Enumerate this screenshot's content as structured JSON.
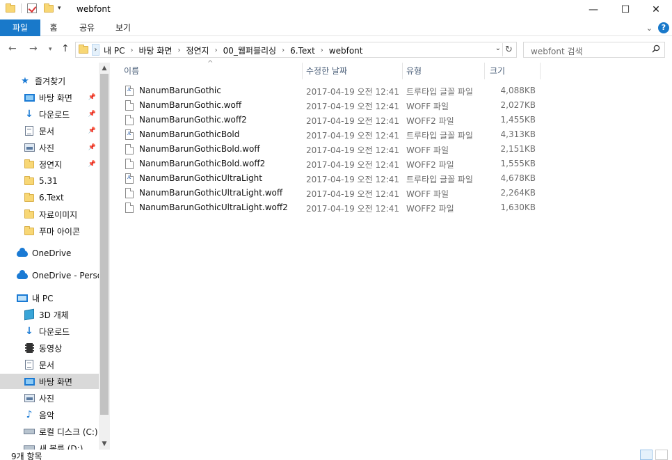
{
  "window": {
    "title": "webfont",
    "minimize": "—",
    "maximize": "☐",
    "close": "✕"
  },
  "ribbon": {
    "tabs": [
      "파일",
      "홈",
      "공유",
      "보기"
    ],
    "help": "?"
  },
  "address": {
    "crumbs": [
      "내 PC",
      "바탕 화면",
      "정연지",
      "00_웹퍼블리싱",
      "6.Text",
      "webfont"
    ],
    "search_placeholder": "webfont 검색"
  },
  "sidebar": {
    "items": [
      {
        "label": "즐겨찾기",
        "icon": "star-icon",
        "pinned": false
      },
      {
        "label": "바탕 화면",
        "icon": "desktop-icon",
        "pinned": true
      },
      {
        "label": "다운로드",
        "icon": "download-icon",
        "pinned": true
      },
      {
        "label": "문서",
        "icon": "document-icon",
        "pinned": true
      },
      {
        "label": "사진",
        "icon": "pictures-icon",
        "pinned": true
      },
      {
        "label": "정연지",
        "icon": "folder-icon",
        "pinned": true
      },
      {
        "label": "5.31",
        "icon": "folder-icon",
        "pinned": false
      },
      {
        "label": "6.Text",
        "icon": "folder-icon",
        "pinned": false
      },
      {
        "label": "자료이미지",
        "icon": "folder-icon",
        "pinned": false
      },
      {
        "label": "푸마 아이콘",
        "icon": "folder-icon",
        "pinned": false
      },
      {
        "label": "OneDrive",
        "icon": "onedrive-icon",
        "pinned": false
      },
      {
        "label": "OneDrive - Personal",
        "icon": "onedrive-icon",
        "pinned": false
      },
      {
        "label": "내 PC",
        "icon": "pc-icon",
        "pinned": false
      },
      {
        "label": "3D 개체",
        "icon": "3d-objects-icon",
        "pinned": false
      },
      {
        "label": "다운로드",
        "icon": "download-icon",
        "pinned": false
      },
      {
        "label": "동영상",
        "icon": "video-icon",
        "pinned": false
      },
      {
        "label": "문서",
        "icon": "document-icon",
        "pinned": false
      },
      {
        "label": "바탕 화면",
        "icon": "desktop-icon",
        "pinned": false,
        "selected": true
      },
      {
        "label": "사진",
        "icon": "pictures-icon",
        "pinned": false
      },
      {
        "label": "음악",
        "icon": "music-icon",
        "pinned": false
      },
      {
        "label": "로컬 디스크 (C:)",
        "icon": "drive-icon",
        "pinned": false
      },
      {
        "label": "새 볼륨 (D:)",
        "icon": "drive-icon",
        "pinned": false
      }
    ]
  },
  "columns": {
    "name": "이름",
    "date": "수정한 날짜",
    "type": "유형",
    "size": "크기"
  },
  "files": [
    {
      "name": "NanumBarunGothic",
      "date": "2017-04-19 오전 12:41",
      "type": "트루타입 글꼴 파일",
      "size": "4,088KB",
      "kind": "font"
    },
    {
      "name": "NanumBarunGothic.woff",
      "date": "2017-04-19 오전 12:41",
      "type": "WOFF 파일",
      "size": "2,027KB",
      "kind": "file"
    },
    {
      "name": "NanumBarunGothic.woff2",
      "date": "2017-04-19 오전 12:41",
      "type": "WOFF2 파일",
      "size": "1,455KB",
      "kind": "file"
    },
    {
      "name": "NanumBarunGothicBold",
      "date": "2017-04-19 오전 12:41",
      "type": "트루타입 글꼴 파일",
      "size": "4,313KB",
      "kind": "font"
    },
    {
      "name": "NanumBarunGothicBold.woff",
      "date": "2017-04-19 오전 12:41",
      "type": "WOFF 파일",
      "size": "2,151KB",
      "kind": "file"
    },
    {
      "name": "NanumBarunGothicBold.woff2",
      "date": "2017-04-19 오전 12:41",
      "type": "WOFF2 파일",
      "size": "1,555KB",
      "kind": "file"
    },
    {
      "name": "NanumBarunGothicUltraLight",
      "date": "2017-04-19 오전 12:41",
      "type": "트루타입 글꼴 파일",
      "size": "4,678KB",
      "kind": "font"
    },
    {
      "name": "NanumBarunGothicUltraLight.woff",
      "date": "2017-04-19 오전 12:41",
      "type": "WOFF 파일",
      "size": "2,264KB",
      "kind": "file"
    },
    {
      "name": "NanumBarunGothicUltraLight.woff2",
      "date": "2017-04-19 오전 12:41",
      "type": "WOFF2 파일",
      "size": "1,630KB",
      "kind": "file"
    }
  ],
  "status": {
    "item_count": "9개 항목"
  },
  "colors": {
    "accent": "#1979ca",
    "selected_bg": "#d9d9d9",
    "folder": "#f8d775"
  }
}
